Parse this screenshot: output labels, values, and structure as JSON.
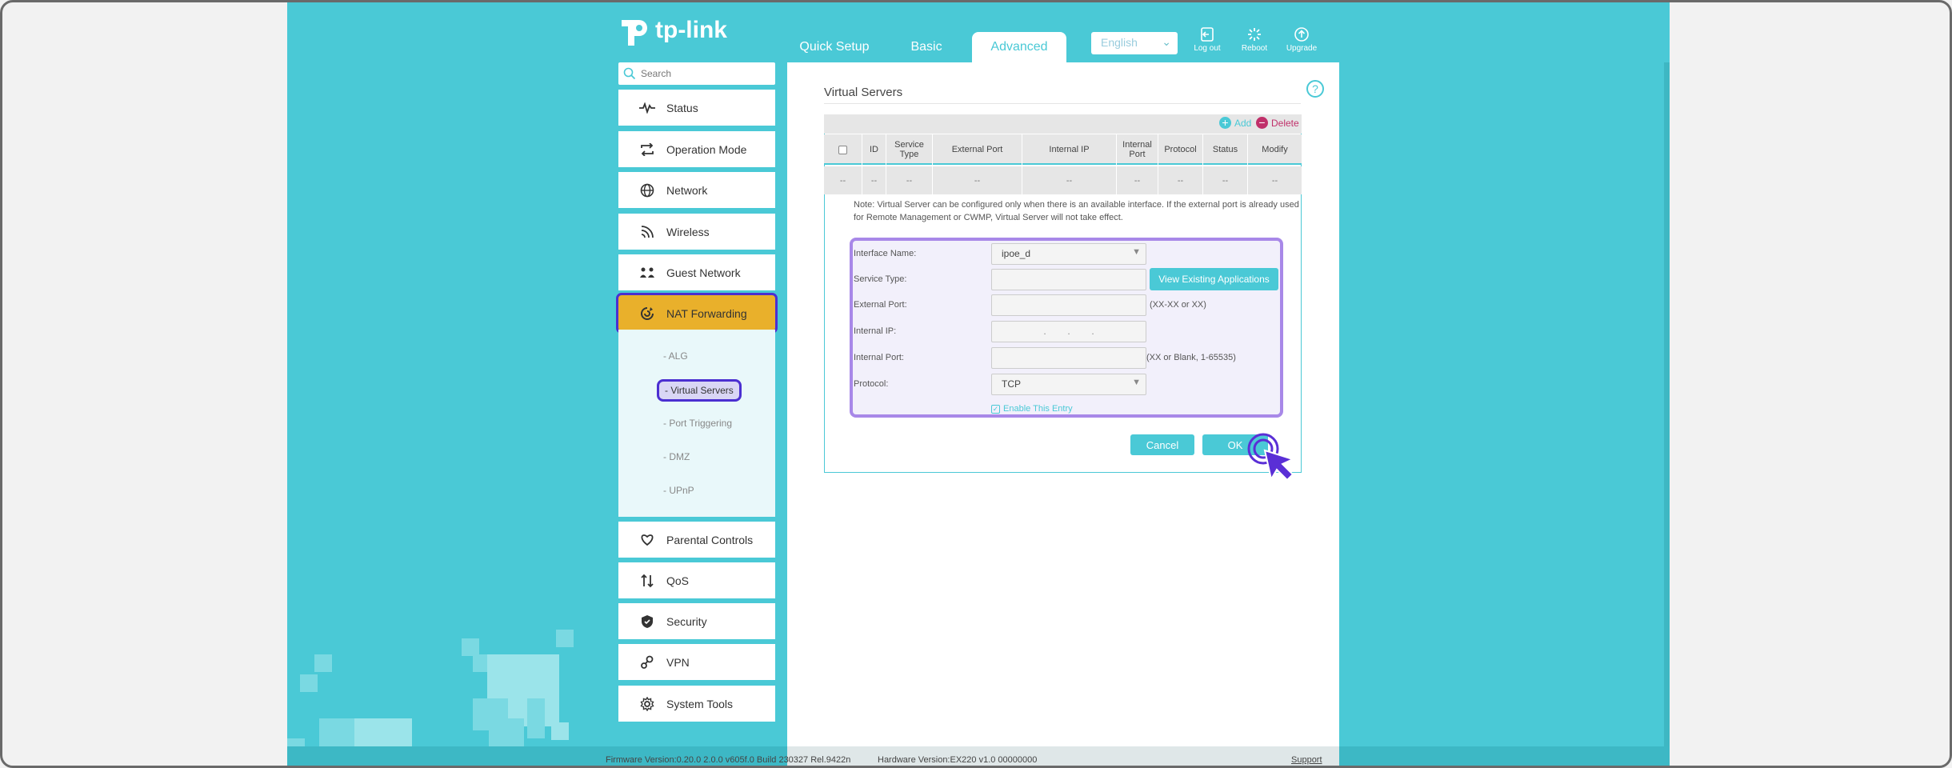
{
  "brand": {
    "logo_text": "tp-link"
  },
  "nav": {
    "tabs": [
      {
        "label": "Quick Setup"
      },
      {
        "label": "Basic"
      },
      {
        "label": "Advanced"
      }
    ],
    "language": "English",
    "actions": [
      {
        "label": "Log out",
        "icon": "logout-icon"
      },
      {
        "label": "Reboot",
        "icon": "reboot-icon"
      },
      {
        "label": "Upgrade",
        "icon": "upgrade-icon"
      }
    ]
  },
  "sidebar": {
    "search_placeholder": "Search",
    "items": [
      {
        "label": "Status",
        "icon": "pulse-icon"
      },
      {
        "label": "Operation Mode",
        "icon": "loop-icon"
      },
      {
        "label": "Network",
        "icon": "globe-icon"
      },
      {
        "label": "Wireless",
        "icon": "wifi-icon"
      },
      {
        "label": "Guest Network",
        "icon": "guests-icon"
      },
      {
        "label": "NAT Forwarding",
        "icon": "nat-icon"
      },
      {
        "label": "Parental Controls",
        "icon": "heart-hands-icon"
      },
      {
        "label": "QoS",
        "icon": "qos-icon"
      },
      {
        "label": "Security",
        "icon": "shield-icon"
      },
      {
        "label": "VPN",
        "icon": "key-icon"
      },
      {
        "label": "System Tools",
        "icon": "gear-icon"
      }
    ],
    "sub_items": [
      {
        "label": "- ALG"
      },
      {
        "label": "- Virtual Servers"
      },
      {
        "label": "- Port Triggering"
      },
      {
        "label": "- DMZ"
      },
      {
        "label": "- UPnP"
      }
    ]
  },
  "content": {
    "title": "Virtual Servers",
    "table": {
      "add_label": "Add",
      "delete_label": "Delete",
      "headers": [
        "ID",
        "Service Type",
        "External Port",
        "Internal IP",
        "Internal Port",
        "Protocol",
        "Status",
        "Modify"
      ],
      "row": [
        "--",
        "--",
        "--",
        "--",
        "--",
        "--",
        "--",
        "--",
        "--"
      ]
    },
    "note_line1": "Note: Virtual Server can be configured only when there is an available interface. If the external port is already used",
    "note_line2": "for Remote Management or CWMP, Virtual Server will not take effect.",
    "form": {
      "interface_label": "Interface Name:",
      "interface_value": "ipoe_d",
      "service_type_label": "Service Type:",
      "view_apps_button": "View Existing Applications",
      "external_port_label": "External Port:",
      "external_port_hint": "(XX-XX or XX)",
      "internal_ip_label": "Internal IP:",
      "internal_ip_dots": ".        .        .",
      "internal_port_label": "Internal Port:",
      "internal_port_hint": "(XX or Blank, 1-65535)",
      "protocol_label": "Protocol:",
      "protocol_value": "TCP",
      "enable_label": "Enable This Entry"
    },
    "cancel_button": "Cancel",
    "ok_button": "OK"
  },
  "footer": {
    "firmware": "Firmware Version:0.20.0 2.0.0 v605f.0 Build 230327 Rel.9422n",
    "hardware": "Hardware Version:EX220 v1.0 00000000",
    "support": "Support"
  },
  "colors": {
    "accent": "#4ac9d6",
    "active_menu": "#e9b02b",
    "highlight": "#4b2fd1",
    "form_border": "#a888e8"
  }
}
